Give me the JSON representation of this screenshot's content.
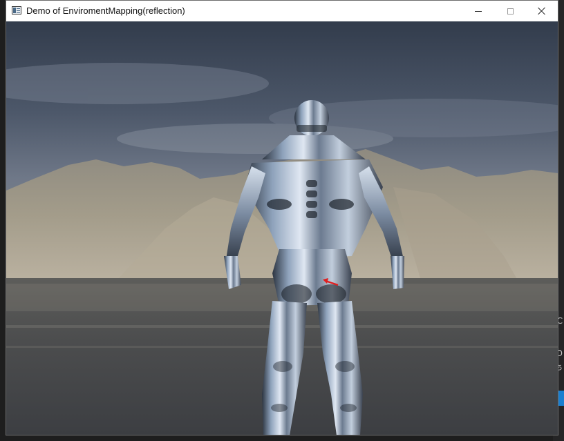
{
  "window": {
    "title": "Demo of EnviromentMapping(reflection)",
    "icons": {
      "app": "app-window-icon",
      "minimize": "minimize-icon",
      "maximize": "maximize-icon",
      "close": "close-icon"
    }
  },
  "scene": {
    "description_icon": "rendered-3d-viewport",
    "colors": {
      "sky_top": "#3b4658",
      "sky_mid": "#6a7484",
      "mountain": "#9a9484",
      "water": "#4a4c4e",
      "chrome": "#8fa3bd",
      "marker": "#e02020"
    }
  },
  "background_ide": {
    "glyphs": [
      "C",
      "O",
      "ち"
    ]
  }
}
